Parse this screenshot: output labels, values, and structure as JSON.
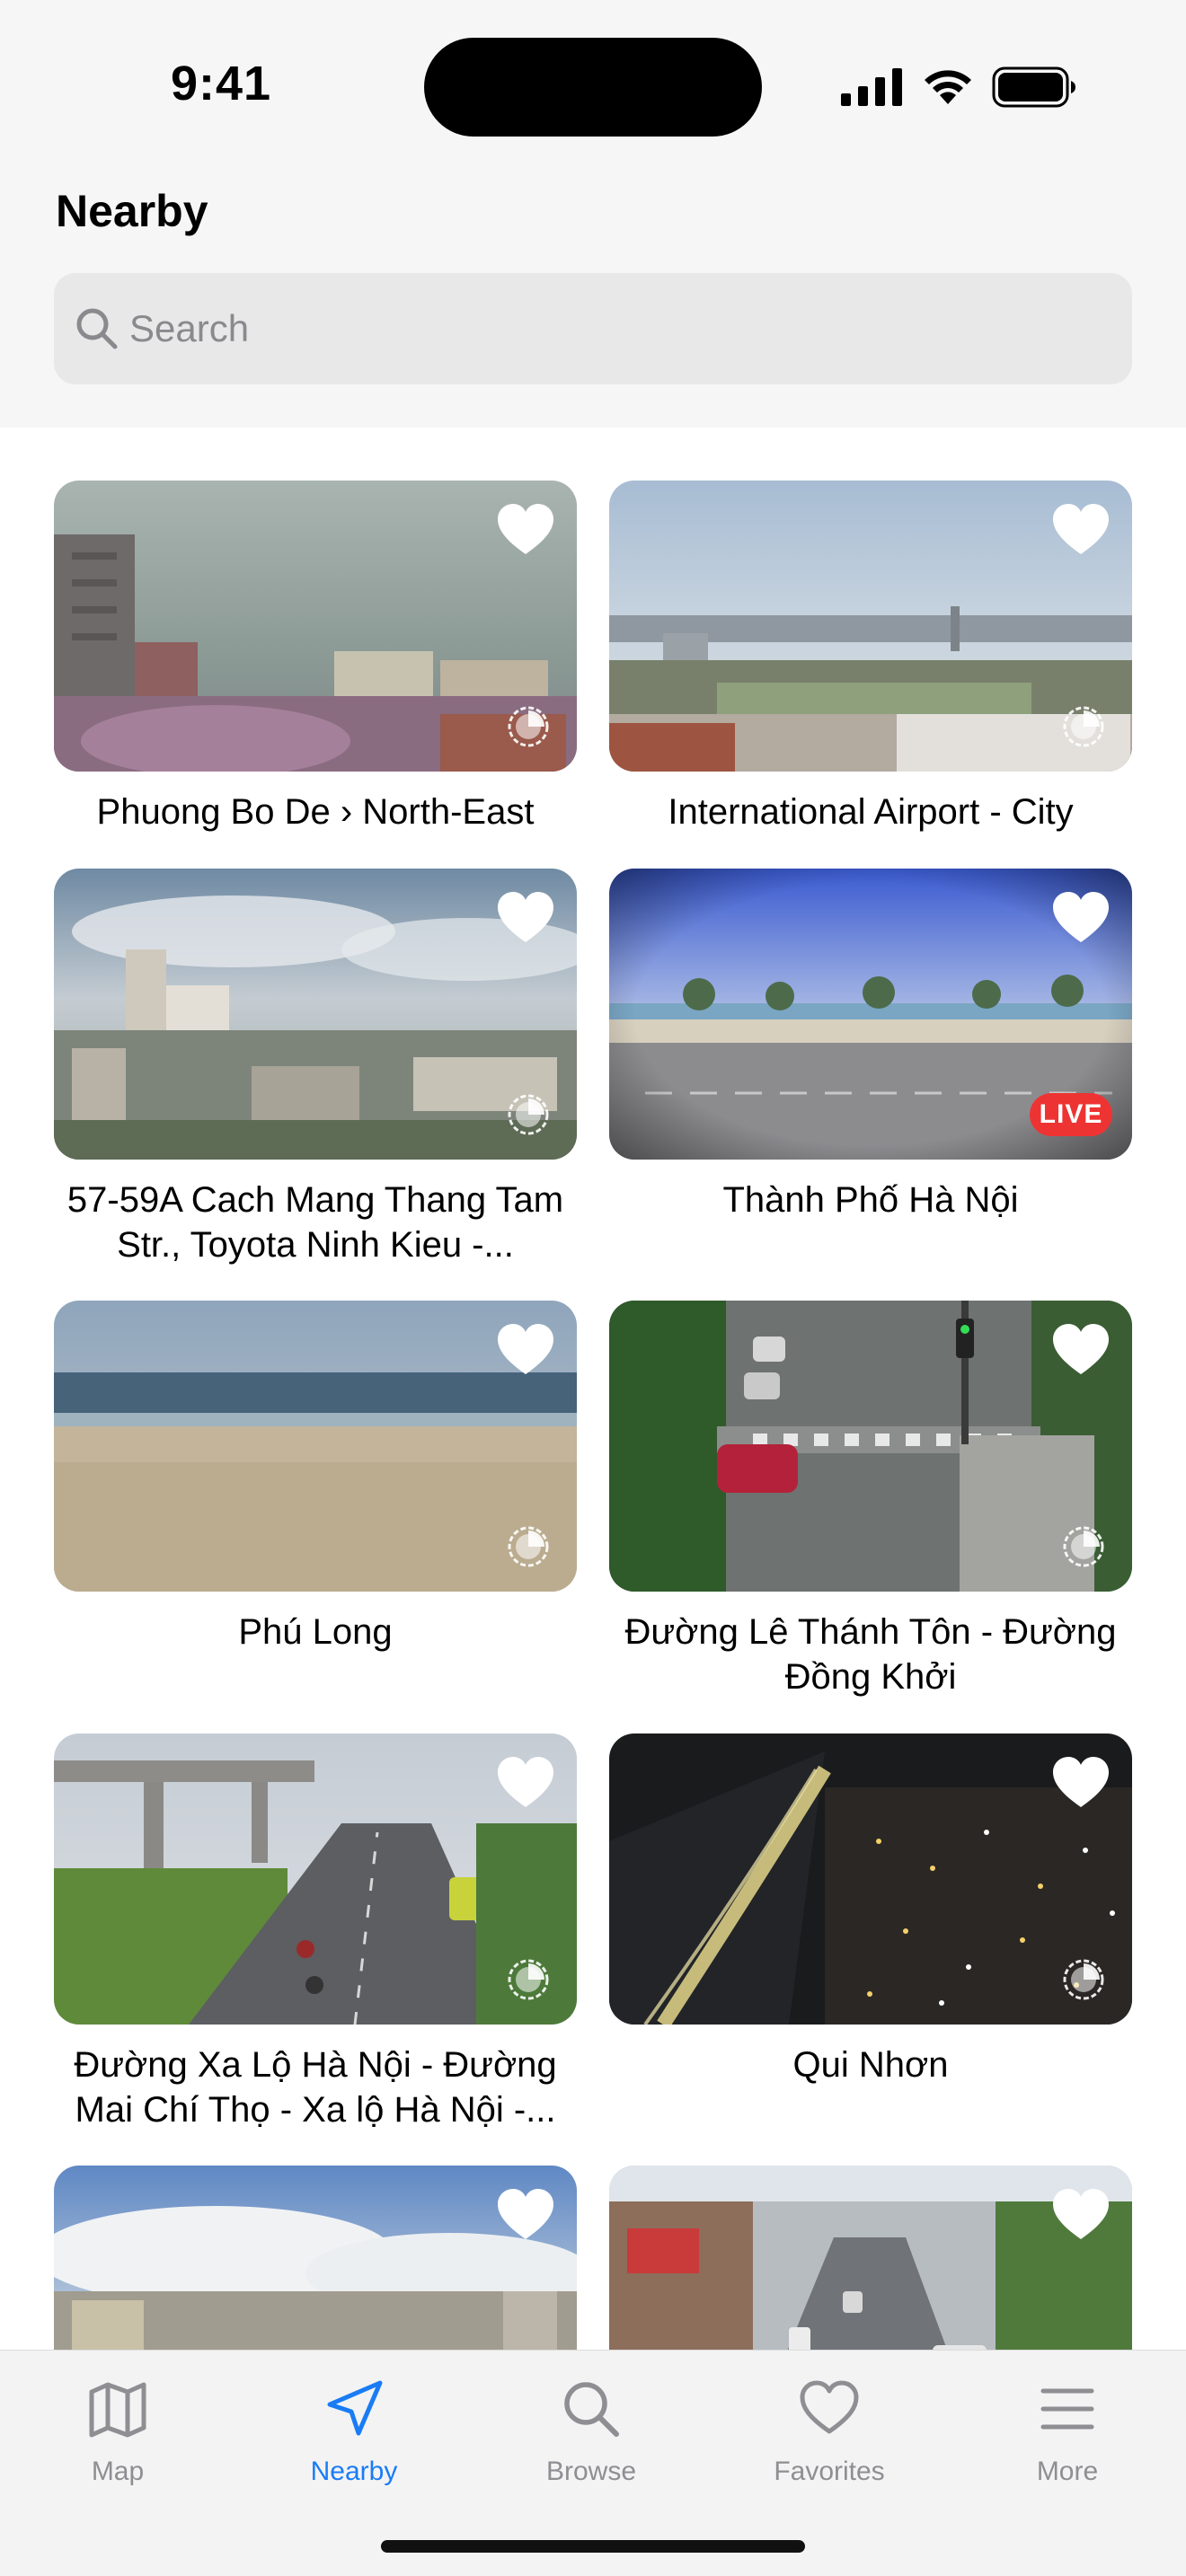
{
  "status_bar": {
    "time": "9:41"
  },
  "header": {
    "title": "Nearby",
    "search_placeholder": "Search"
  },
  "cameras": [
    {
      "name": "Phuong Bo De › North-East",
      "favorite": true,
      "badge": "timelapse",
      "scene": "city-haze"
    },
    {
      "name": "International Airport - City",
      "favorite": true,
      "badge": "timelapse",
      "scene": "city-rooftops"
    },
    {
      "name": "57-59A Cach Mang Thang Tam Str., Toyota Ninh Kieu -...",
      "favorite": true,
      "badge": "timelapse",
      "scene": "city-cloudy"
    },
    {
      "name": "Thành Phố Hà Nội",
      "favorite": true,
      "badge": "LIVE",
      "scene": "seaside-road"
    },
    {
      "name": "Phú Long",
      "favorite": true,
      "badge": "timelapse",
      "scene": "beach"
    },
    {
      "name": "Đường Lê Thánh Tôn - Đường Đồng Khởi",
      "favorite": true,
      "badge": "timelapse",
      "scene": "street-intersection"
    },
    {
      "name": "Đường Xa Lộ Hà Nội - Đường Mai Chí Thọ - Xa lộ Hà Nội -...",
      "favorite": true,
      "badge": "timelapse",
      "scene": "highway"
    },
    {
      "name": "Qui Nhơn",
      "favorite": true,
      "badge": "timelapse",
      "scene": "night-city"
    },
    {
      "name": "",
      "favorite": true,
      "badge": "",
      "scene": "sky-buildings"
    },
    {
      "name": "",
      "favorite": true,
      "badge": "",
      "scene": "busy-street"
    }
  ],
  "tabs": [
    {
      "label": "Map",
      "icon": "map-icon",
      "active": false
    },
    {
      "label": "Nearby",
      "icon": "location-arrow-icon",
      "active": true
    },
    {
      "label": "Browse",
      "icon": "magnifier-icon",
      "active": false
    },
    {
      "label": "Favorites",
      "icon": "heart-icon",
      "active": false
    },
    {
      "label": "More",
      "icon": "menu-lines-icon",
      "active": false
    }
  ],
  "colors": {
    "accent": "#1a7cf5",
    "live": "#ee3333",
    "inactive_tab": "#8e8e93"
  }
}
